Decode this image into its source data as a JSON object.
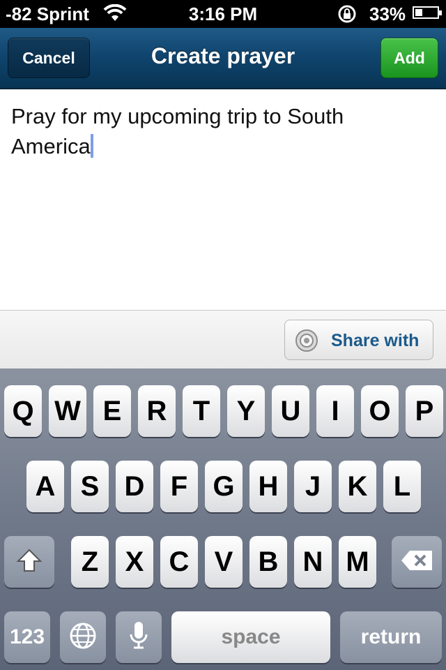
{
  "status_bar": {
    "carrier": "-82 Sprint",
    "time": "3:16 PM",
    "battery_percent": "33%",
    "battery_level": 0.33
  },
  "navbar": {
    "cancel_label": "Cancel",
    "title": "Create prayer",
    "add_label": "Add"
  },
  "editor": {
    "text_line1": "Pray for my upcoming trip to South",
    "text_line2": "America"
  },
  "share": {
    "label": "Share with"
  },
  "keyboard": {
    "row1": [
      "Q",
      "W",
      "E",
      "R",
      "T",
      "Y",
      "U",
      "I",
      "O",
      "P"
    ],
    "row2": [
      "A",
      "S",
      "D",
      "F",
      "G",
      "H",
      "J",
      "K",
      "L"
    ],
    "row3": [
      "Z",
      "X",
      "C",
      "V",
      "B",
      "N",
      "M"
    ],
    "numbers_label": "123",
    "space_label": "space",
    "return_label": "return"
  }
}
